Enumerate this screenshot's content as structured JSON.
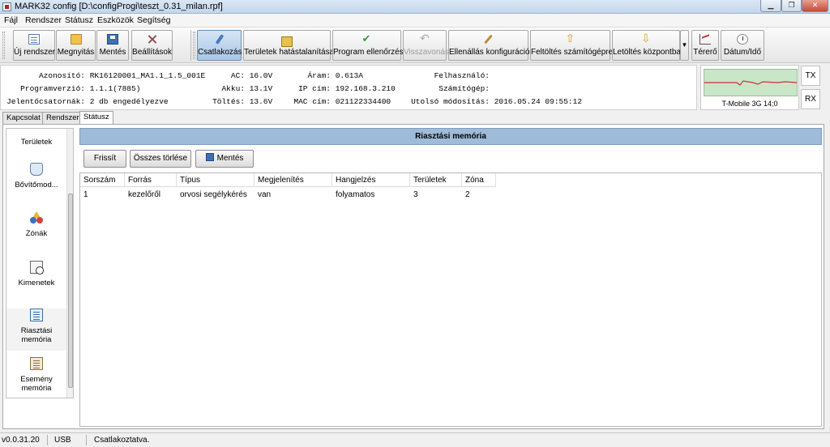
{
  "window": {
    "title": "MARK32 config [D:\\configProgi\\teszt_0.31_milan.rpf]"
  },
  "menu": [
    "Fájl",
    "Rendszer",
    "Státusz",
    "Eszközök",
    "Segítség"
  ],
  "toolbar": {
    "new_system": "Új rendszer",
    "open": "Megnyitás",
    "save": "Mentés",
    "settings": "Beállítások",
    "connect": "Csatlakozás",
    "disable_areas": "Területek hatástalanítása",
    "program_check": "Program ellenőrzés",
    "revert": "Visszavonás",
    "resistance_config": "Ellenállás konfiguráció",
    "upload_pc": "Feltöltés számítógépre",
    "download_panel": "Letöltés központba",
    "signal": "Térerő",
    "datetime": "Dátum/Idő"
  },
  "info": {
    "id_label": "Azonosító:",
    "id_value": "RK16120001_MA1.1_1.5_001E",
    "version_label": "Programverzió:",
    "version_value": "1.1.1(7885)",
    "channels_label": "Jelentőcsatornák:",
    "channels_value": "2 db engedélyezve",
    "ac_label": "AC:",
    "ac_value": "16.0V",
    "battery_label": "Akku:",
    "battery_value": "13.1V",
    "charge_label": "Töltés:",
    "charge_value": "13.6V",
    "current_label": "Áram:",
    "current_value": "0.613A",
    "ip_label": "IP cím:",
    "ip_value": "192.168.3.210",
    "mac_label": "MAC cím:",
    "mac_value": "021122334400",
    "user_label": "Felhasználó:",
    "user_value": "",
    "computer_label": "Számítógép:",
    "computer_value": "",
    "modified_label": "Utolsó módosítás:",
    "modified_value": "2016.05.24 09:55:12"
  },
  "signal": {
    "label": "T-Mobile 3G 14;0",
    "tx": "TX",
    "rx": "RX"
  },
  "tabs": [
    "Kapcsolat",
    "Rendszer",
    "Státusz"
  ],
  "nav": {
    "areas": "Területek",
    "modules": "Bővítőmod...",
    "zones": "Zónák",
    "outputs": "Kimenetek",
    "alarm_memory_1": "Riasztási",
    "alarm_memory_2": "memória",
    "event_memory_1": "Esemény",
    "event_memory_2": "memória"
  },
  "panel": {
    "title": "Riasztási memória",
    "refresh": "Frissít",
    "clear_all": "Összes törlése",
    "save": "Mentés"
  },
  "table": {
    "columns": [
      "Sorszám",
      "Forrás",
      "Típus",
      "Megjelenítés",
      "Hangjelzés",
      "Területek",
      "Zóna"
    ],
    "rows": [
      [
        "1",
        "kezelőről",
        "orvosi segélykérés",
        "van",
        "folyamatos",
        "3",
        "2"
      ]
    ]
  },
  "status": {
    "version": "v0.0.31.20",
    "conn_type": "USB",
    "message": "Csatlakoztatva."
  },
  "colors": {
    "header_bar": "#9ebbd9",
    "signal_bg": "#c9e6c9",
    "signal_line": "#d03030"
  }
}
